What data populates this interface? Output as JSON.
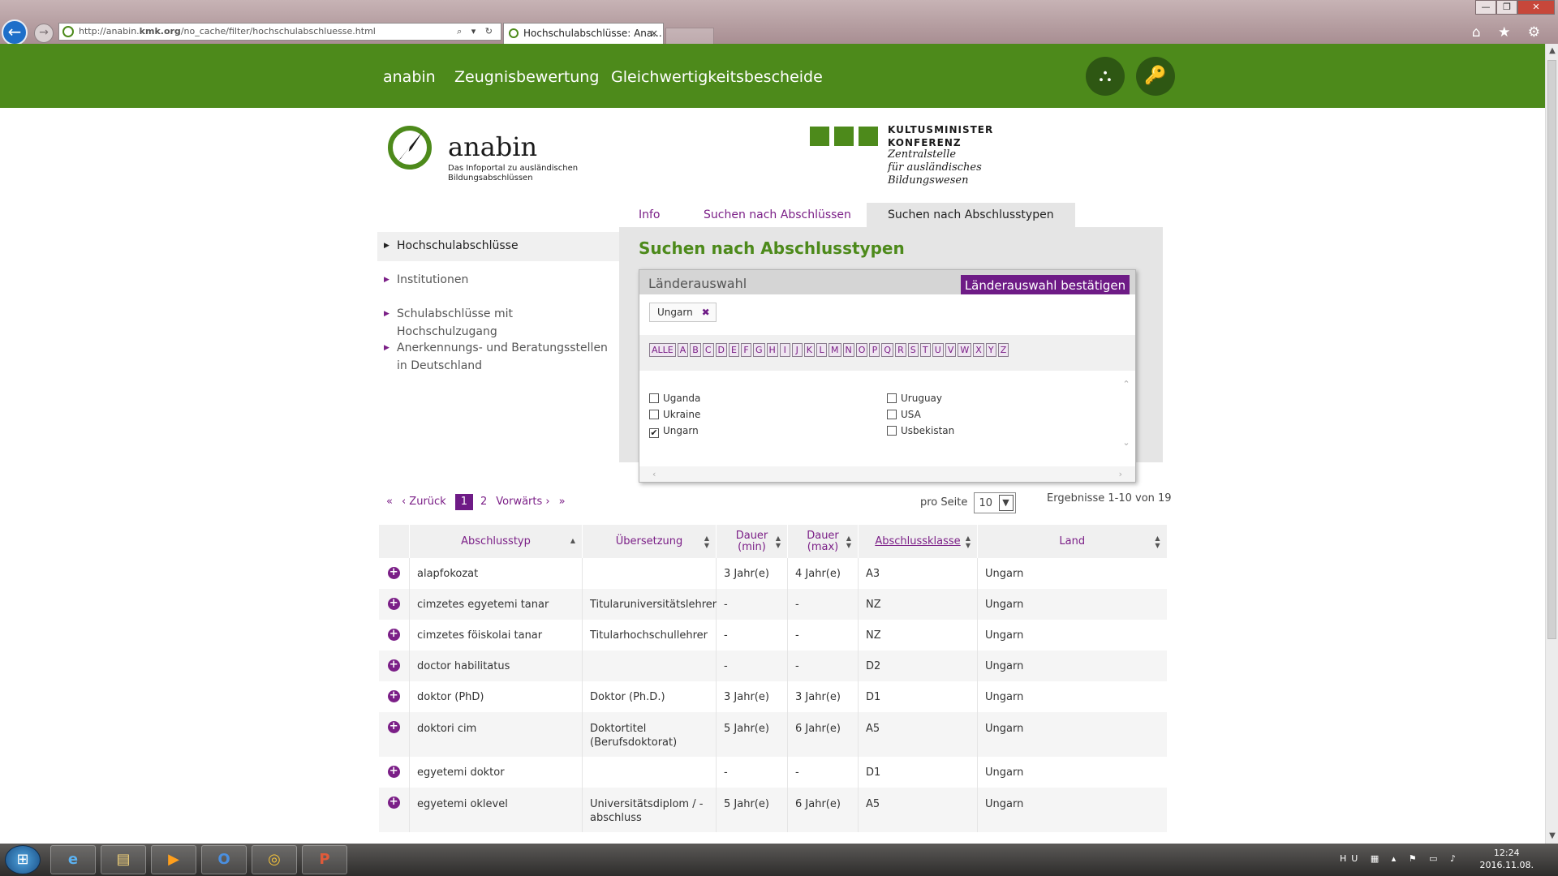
{
  "browser": {
    "url_host": "http://anabin.",
    "url_domain": "kmk.org",
    "url_path": "/no_cache/filter/hochschulabschluesse.html",
    "tab_title": "Hochschulabschlüsse: Ana...",
    "tab_close": "×",
    "address_tools": "⌕ ▾ ↻",
    "win_minimize": "—",
    "win_restore": "❐",
    "win_close": "✕",
    "chrome_icons": "⌂ ★ ⚙"
  },
  "topnav": {
    "items": [
      "anabin",
      "Zeugnisbewertung",
      "Gleichwertigkeitsbescheide"
    ],
    "sitemap_glyph": "⛬",
    "login_glyph": "🔑"
  },
  "logo": {
    "name": "anabin",
    "subtitle": "Das Infoportal zu ausländischen Bildungsabschlüssen"
  },
  "kmk": {
    "line1": "KULTUSMINISTER",
    "line2": "KONFERENZ",
    "italic1": "Zentralstelle",
    "italic2": "für ausländisches",
    "italic3": "Bildungswesen"
  },
  "content_tabs": [
    "Info",
    "Suchen nach Abschlüssen",
    "Suchen nach Abschlusstypen"
  ],
  "sidebar": {
    "items": [
      "Hochschulabschlüsse",
      "Institutionen",
      "Schulabschlüsse mit Hochschulzugang",
      "Anerkennungs- und Beratungsstellen in Deutschland"
    ]
  },
  "main": {
    "title": "Suchen nach Abschlusstypen"
  },
  "popup": {
    "title": "Länderauswahl",
    "confirm": "Länderauswahl bestätigen",
    "chip": "Ungarn",
    "chip_remove": "✖",
    "alphabet": [
      "ALLE",
      "A",
      "B",
      "C",
      "D",
      "E",
      "F",
      "G",
      "H",
      "I",
      "J",
      "K",
      "L",
      "M",
      "N",
      "O",
      "P",
      "Q",
      "R",
      "S",
      "T",
      "U",
      "V",
      "W",
      "X",
      "Y",
      "Z"
    ],
    "countries_left": [
      {
        "name": "Uganda",
        "checked": false
      },
      {
        "name": "Ukraine",
        "checked": false
      },
      {
        "name": "Ungarn",
        "checked": true
      }
    ],
    "countries_right": [
      {
        "name": "Uruguay",
        "checked": false
      },
      {
        "name": "USA",
        "checked": false
      },
      {
        "name": "Usbekistan",
        "checked": false
      }
    ]
  },
  "pager": {
    "first": "«",
    "prev": "‹ Zurück",
    "pages": [
      "1",
      "2"
    ],
    "current": "1",
    "next": "Vorwärts ›",
    "last": "»"
  },
  "per_page": {
    "label": "pro Seite",
    "value": "10"
  },
  "results_text": "Ergebnisse 1-10 von 19",
  "table": {
    "headers": [
      "Abschlusstyp",
      "Übersetzung",
      "Dauer (min)",
      "Dauer (max)",
      "Abschlussklasse",
      "Land"
    ],
    "rows": [
      [
        "alapfokozat",
        "",
        "3 Jahr(e)",
        "4 Jahr(e)",
        "A3",
        "Ungarn"
      ],
      [
        "cimzetes egyetemi tanar",
        "Titularuniversitätslehrer",
        "-",
        "-",
        "NZ",
        "Ungarn"
      ],
      [
        "cimzetes föiskolai tanar",
        "Titularhochschullehrer",
        "-",
        "-",
        "NZ",
        "Ungarn"
      ],
      [
        "doctor habilitatus",
        "",
        "-",
        "-",
        "D2",
        "Ungarn"
      ],
      [
        "doktor (PhD)",
        "Doktor (Ph.D.)",
        "3 Jahr(e)",
        "3 Jahr(e)",
        "D1",
        "Ungarn"
      ],
      [
        "doktori cim",
        "Doktortitel (Berufsdoktorat)",
        "5 Jahr(e)",
        "6 Jahr(e)",
        "A5",
        "Ungarn"
      ],
      [
        "egyetemi doktor",
        "",
        "-",
        "-",
        "D1",
        "Ungarn"
      ],
      [
        "egyetemi oklevel",
        "Universitätsdiplom / -abschluss",
        "5 Jahr(e)",
        "6 Jahr(e)",
        "A5",
        "Ungarn"
      ]
    ]
  },
  "taskbar": {
    "tray_lang": "HU",
    "time": "12:24",
    "date": "2016.11.08."
  },
  "colors": {
    "brand_green": "#4d8a1b",
    "accent_purple": "#7b1f87",
    "button_purple": "#6e1b86"
  }
}
